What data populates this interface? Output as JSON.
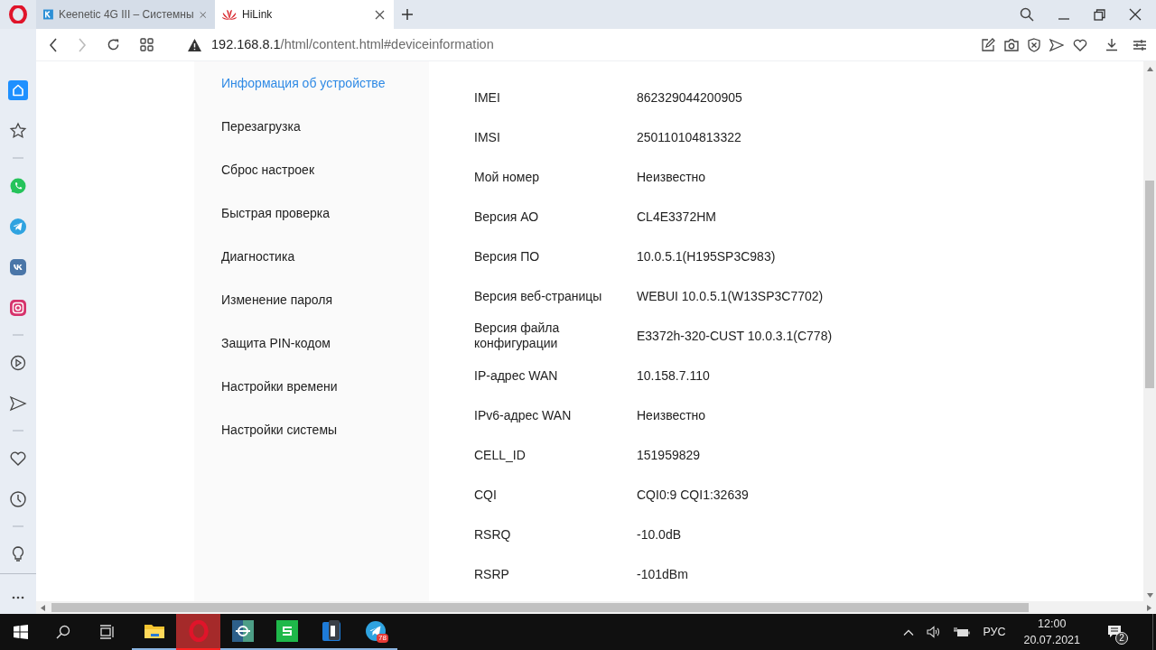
{
  "tabs": [
    {
      "title": "Keenetic 4G III – Системны",
      "kind": "keenetic",
      "selected": false
    },
    {
      "title": "HiLink",
      "kind": "huawei",
      "selected": true
    }
  ],
  "address": {
    "host": "192.168.8.1",
    "path": "/html/content.html#deviceinformation"
  },
  "menu": [
    {
      "label": "Информация об устройстве",
      "selected": true
    },
    {
      "label": "Перезагрузка",
      "selected": false
    },
    {
      "label": "Сброс настроек",
      "selected": false
    },
    {
      "label": "Быстрая проверка",
      "selected": false
    },
    {
      "label": "Диагностика",
      "selected": false
    },
    {
      "label": "Изменение пароля",
      "selected": false
    },
    {
      "label": "Защита PIN-кодом",
      "selected": false
    },
    {
      "label": "Настройки времени",
      "selected": false
    },
    {
      "label": "Настройки системы",
      "selected": false
    }
  ],
  "info_rows": [
    {
      "label": "IMEI",
      "value": "862329044200905"
    },
    {
      "label": "IMSI",
      "value": "250110104813322"
    },
    {
      "label": "Мой номер",
      "value": "Неизвестно"
    },
    {
      "label": "Версия АО",
      "value": "CL4E3372HM"
    },
    {
      "label": "Версия ПО",
      "value": "10.0.5.1(H195SP3C983)"
    },
    {
      "label": "Версия веб-страницы",
      "value": "WEBUI 10.0.5.1(W13SP3C7702)"
    },
    {
      "label": "Версия файла конфигурации",
      "value": "E3372h-320-CUST 10.0.3.1(C778)"
    },
    {
      "label": "IP-адрес WAN",
      "value": "10.158.7.110"
    },
    {
      "label": "IPv6-адрес WAN",
      "value": "Неизвестно"
    },
    {
      "label": "CELL_ID",
      "value": "151959829"
    },
    {
      "label": "CQI",
      "value": "CQI0:9 CQI1:32639"
    },
    {
      "label": "RSRQ",
      "value": "-10.0dB"
    },
    {
      "label": "RSRP",
      "value": "-101dBm"
    }
  ],
  "taskbar": {
    "apps": [
      {
        "kind": "explorer",
        "active": false
      },
      {
        "kind": "opera",
        "active": true
      },
      {
        "kind": "remote",
        "active": false
      },
      {
        "kind": "green",
        "active": false
      },
      {
        "kind": "blue",
        "active": false
      },
      {
        "kind": "telegram",
        "active": false,
        "badge": "78"
      }
    ],
    "language": "РУС",
    "time": "12:00",
    "date": "20.07.2021",
    "notifications": "2"
  }
}
